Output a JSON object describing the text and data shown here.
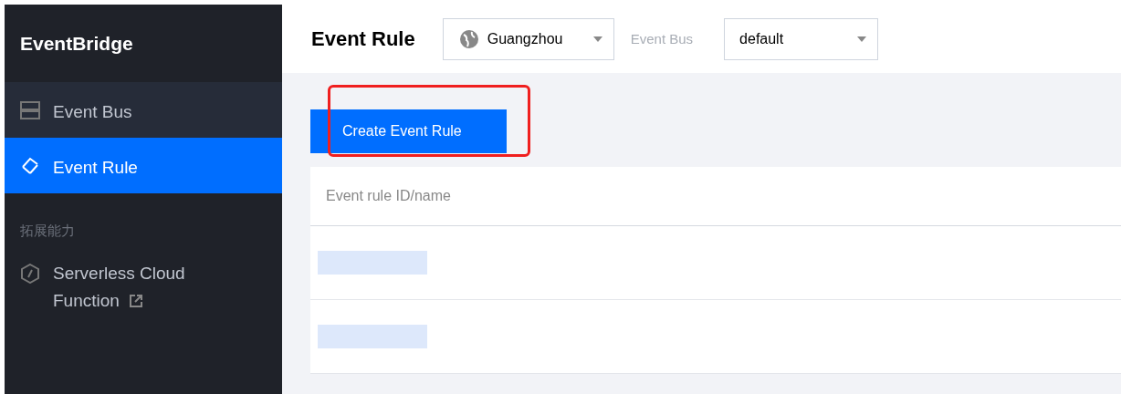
{
  "sidebar": {
    "title": "EventBridge",
    "items": [
      {
        "kind": "bus",
        "label": "Event Bus",
        "selected": false,
        "hovered": true
      },
      {
        "kind": "rule",
        "label": "Event Rule",
        "selected": true,
        "hovered": false
      }
    ],
    "section": {
      "label": "拓展能力",
      "items": [
        {
          "kind": "external",
          "label": "Serverless Cloud Function",
          "selected": false,
          "hovered": false
        }
      ]
    }
  },
  "header": {
    "title": "Event Rule",
    "region": {
      "value": "Guangzhou"
    },
    "bus_label": "Event Bus",
    "bus": {
      "value": "default"
    }
  },
  "toolbar": {
    "create_button": "Create Event Rule",
    "highlighted": true
  },
  "table": {
    "columns": [
      "Event rule ID/name"
    ],
    "rows": [
      {
        "redacted": true
      },
      {
        "redacted": true
      }
    ]
  }
}
